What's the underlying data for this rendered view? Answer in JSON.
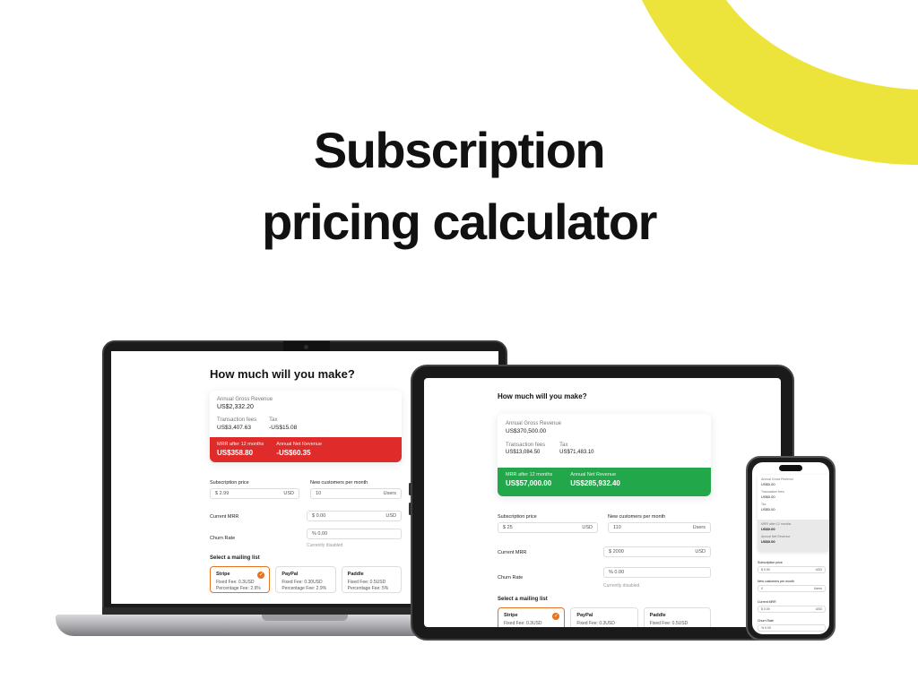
{
  "headline": {
    "line1": "Subscription",
    "line2": "pricing calculator"
  },
  "colors": {
    "accent_yellow": "#ece43b",
    "red": "#e02b2b",
    "green": "#22a84a",
    "orange": "#e5731f"
  },
  "laptop": {
    "title": "How much will you make?",
    "gross_label": "Annual Gross Revenue",
    "gross_value": "US$2,332.20",
    "fees_label": "Transaction fees",
    "fees_value": "US$3,407.63",
    "tax_label": "Tax",
    "tax_value": "-US$15.08",
    "mrr_label": "MRR after 12 months",
    "mrr_value": "US$358.80",
    "net_label": "Annual Net Revenue",
    "net_value": "-US$60.35",
    "sub_price_label": "Subscription price",
    "sub_price_prefix": "$",
    "sub_price_value": "2.99",
    "sub_price_unit": "USD",
    "new_cust_label": "New customers per month",
    "new_cust_value": "10",
    "new_cust_unit": "Users",
    "current_mrr_label": "Current MRR",
    "current_mrr_value": "$ 0.00",
    "current_mrr_unit": "USD",
    "churn_label": "Churn Rate",
    "churn_value": "% 0.00",
    "churn_hint": "Currently disabled",
    "mailing_title": "Select a mailing list",
    "mailing": [
      {
        "name": "Stripe",
        "fixed": "Fixed Fee: 0.3USD",
        "pct": "Percentage Fee: 2.9%"
      },
      {
        "name": "PayPal",
        "fixed": "Fixed Fee: 0.30USD",
        "pct": "Percentage Fee: 2.9%"
      },
      {
        "name": "Paddle",
        "fixed": "Fixed Fee: 0.5USD",
        "pct": "Percentage Fee: 5%"
      }
    ]
  },
  "tablet": {
    "title": "How much will you make?",
    "gross_label": "Annual Gross Revenue",
    "gross_value": "US$370,500.00",
    "fees_label": "Transaction fees",
    "fees_value": "US$13,084.50",
    "tax_label": "Tax",
    "tax_value": "US$71,483.10",
    "mrr_label": "MRR after 12 months",
    "mrr_value": "US$57,000.00",
    "net_label": "Annual Net Revenue",
    "net_value": "US$285,932.40",
    "sub_price_label": "Subscription price",
    "sub_price_prefix": "$",
    "sub_price_value": "25",
    "sub_price_unit": "USD",
    "new_cust_label": "New customers per month",
    "new_cust_value": "110",
    "new_cust_unit": "Users",
    "current_mrr_label": "Current MRR",
    "current_mrr_value": "$ 2000",
    "current_mrr_unit": "USD",
    "churn_label": "Churn Rate",
    "churn_value": "% 0.00",
    "churn_hint": "Currently disabled",
    "mailing_title": "Select a mailing list",
    "mailing": [
      {
        "name": "Stripe",
        "fixed": "Fixed Fee: 0.3USD"
      },
      {
        "name": "PayPal",
        "fixed": "Fixed Fee: 0.3USD"
      },
      {
        "name": "Paddle",
        "fixed": "Fixed Fee: 0.5USD"
      }
    ]
  },
  "phone": {
    "gross_label": "Annual Gross Revenue",
    "gross_value": "US$0.00",
    "fees_label": "Transaction fees",
    "fees_value": "US$0.00",
    "tax_label": "Tax",
    "tax_value": "US$0.00",
    "mrr_label": "MRR after 12 months",
    "mrr_value": "US$0.00",
    "net_label": "Annual Net Revenue",
    "net_value": "US$0.00",
    "sub_price_label": "Subscription price",
    "sub_price_value": "$ 0.00",
    "sub_price_unit": "USD",
    "new_cust_label": "New customers per month",
    "new_cust_value": "0",
    "new_cust_unit": "Users",
    "current_mrr_label": "Current MRR",
    "current_mrr_value": "$ 0.00",
    "current_mrr_unit": "USD",
    "churn_label": "Churn Rate",
    "churn_value": "% 0.00"
  }
}
